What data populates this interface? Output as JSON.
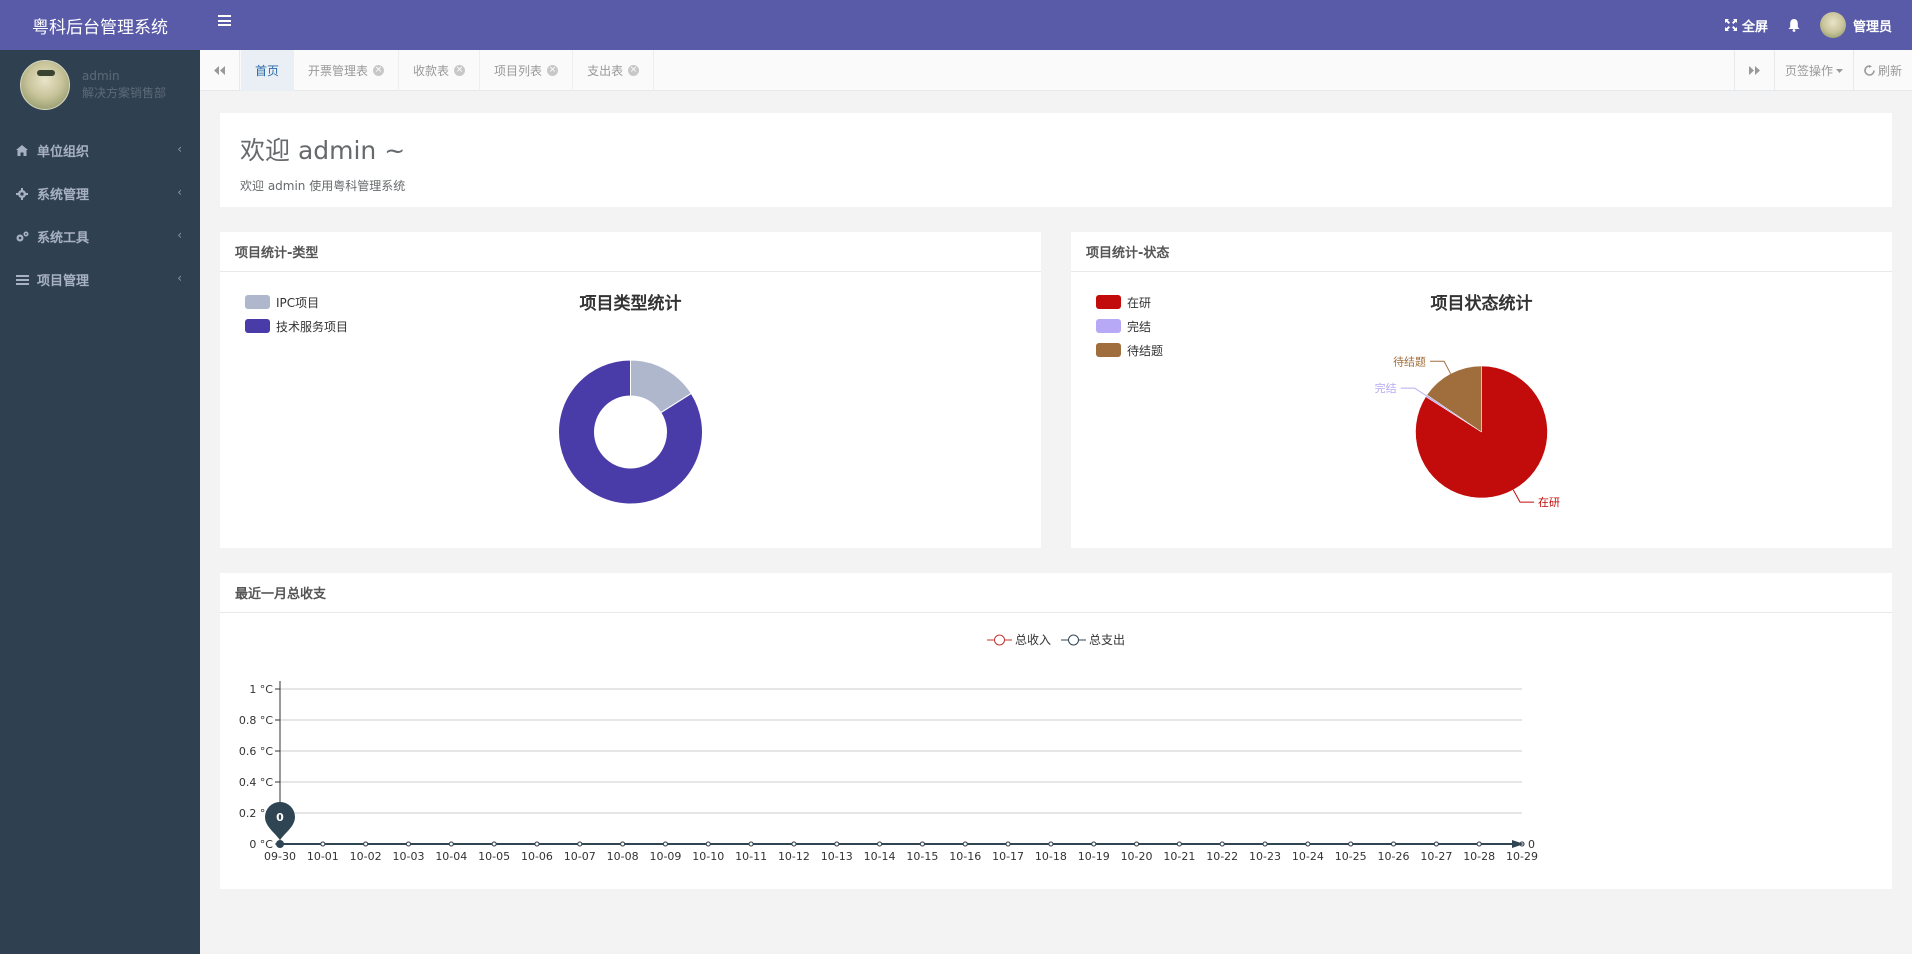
{
  "app": {
    "title": "粤科后台管理系统"
  },
  "profile": {
    "name": "admin",
    "department": "解决方案销售部"
  },
  "sidebar": {
    "items": [
      {
        "label": "单位组织",
        "icon": "home-icon"
      },
      {
        "label": "系统管理",
        "icon": "gear-icon"
      },
      {
        "label": "系统工具",
        "icon": "cogs-icon"
      },
      {
        "label": "项目管理",
        "icon": "list-icon"
      }
    ],
    "chevron": "‹"
  },
  "topbar": {
    "fullscreen_label": "全屏",
    "user_label": "管理员"
  },
  "tabs": {
    "items": [
      {
        "label": "首页",
        "active": true
      },
      {
        "label": "开票管理表"
      },
      {
        "label": "收款表"
      },
      {
        "label": "项目列表"
      },
      {
        "label": "支出表"
      }
    ],
    "page_ops_label": "页签操作",
    "refresh_label": "刷新"
  },
  "welcome": {
    "heading": "欢迎 admin ~",
    "sub": "欢迎 admin 使用粤科管理系统"
  },
  "panels": {
    "type_title": "项目统计-类型",
    "status_title": "项目统计-状态",
    "finance_title": "最近一月总收支"
  },
  "chart_data": [
    {
      "type": "pie",
      "variant": "donut",
      "title": "项目类型统计",
      "legend_position": "top-left",
      "labels": [
        "IPC项目",
        "技术服务项目"
      ],
      "values": [
        16,
        84
      ],
      "colors": [
        "#aeb7cc",
        "#4a3ca8"
      ]
    },
    {
      "type": "pie",
      "title": "项目状态统计",
      "legend_position": "top-left",
      "labels": [
        "在研",
        "完结",
        "待结题"
      ],
      "values": [
        84,
        0.5,
        15.5
      ],
      "colors": [
        "#c20c0c",
        "#b7a9f5",
        "#a06e3c"
      ]
    },
    {
      "type": "line",
      "title": "",
      "legend_position": "top-center",
      "x": [
        "09-30",
        "10-01",
        "10-02",
        "10-03",
        "10-04",
        "10-05",
        "10-06",
        "10-07",
        "10-08",
        "10-09",
        "10-10",
        "10-11",
        "10-12",
        "10-13",
        "10-14",
        "10-15",
        "10-16",
        "10-17",
        "10-18",
        "10-19",
        "10-20",
        "10-21",
        "10-22",
        "10-23",
        "10-24",
        "10-25",
        "10-26",
        "10-27",
        "10-28",
        "10-29"
      ],
      "series": [
        {
          "name": "总收入",
          "color": "#c23531",
          "values": [
            0,
            0,
            0,
            0,
            0,
            0,
            0,
            0,
            0,
            0,
            0,
            0,
            0,
            0,
            0,
            0,
            0,
            0,
            0,
            0,
            0,
            0,
            0,
            0,
            0,
            0,
            0,
            0,
            0,
            0
          ]
        },
        {
          "name": "总支出",
          "color": "#2f4554",
          "values": [
            0,
            0,
            0,
            0,
            0,
            0,
            0,
            0,
            0,
            0,
            0,
            0,
            0,
            0,
            0,
            0,
            0,
            0,
            0,
            0,
            0,
            0,
            0,
            0,
            0,
            0,
            0,
            0,
            0,
            0
          ]
        }
      ],
      "y_ticks": [
        "0 °C",
        "0.2 °C",
        "0.4 °C",
        "0.6 °C",
        "0.8 °C",
        "1 °C"
      ],
      "ylim": [
        0,
        1
      ],
      "grid": true,
      "max_marker_label": "0",
      "end_label": "0"
    }
  ]
}
